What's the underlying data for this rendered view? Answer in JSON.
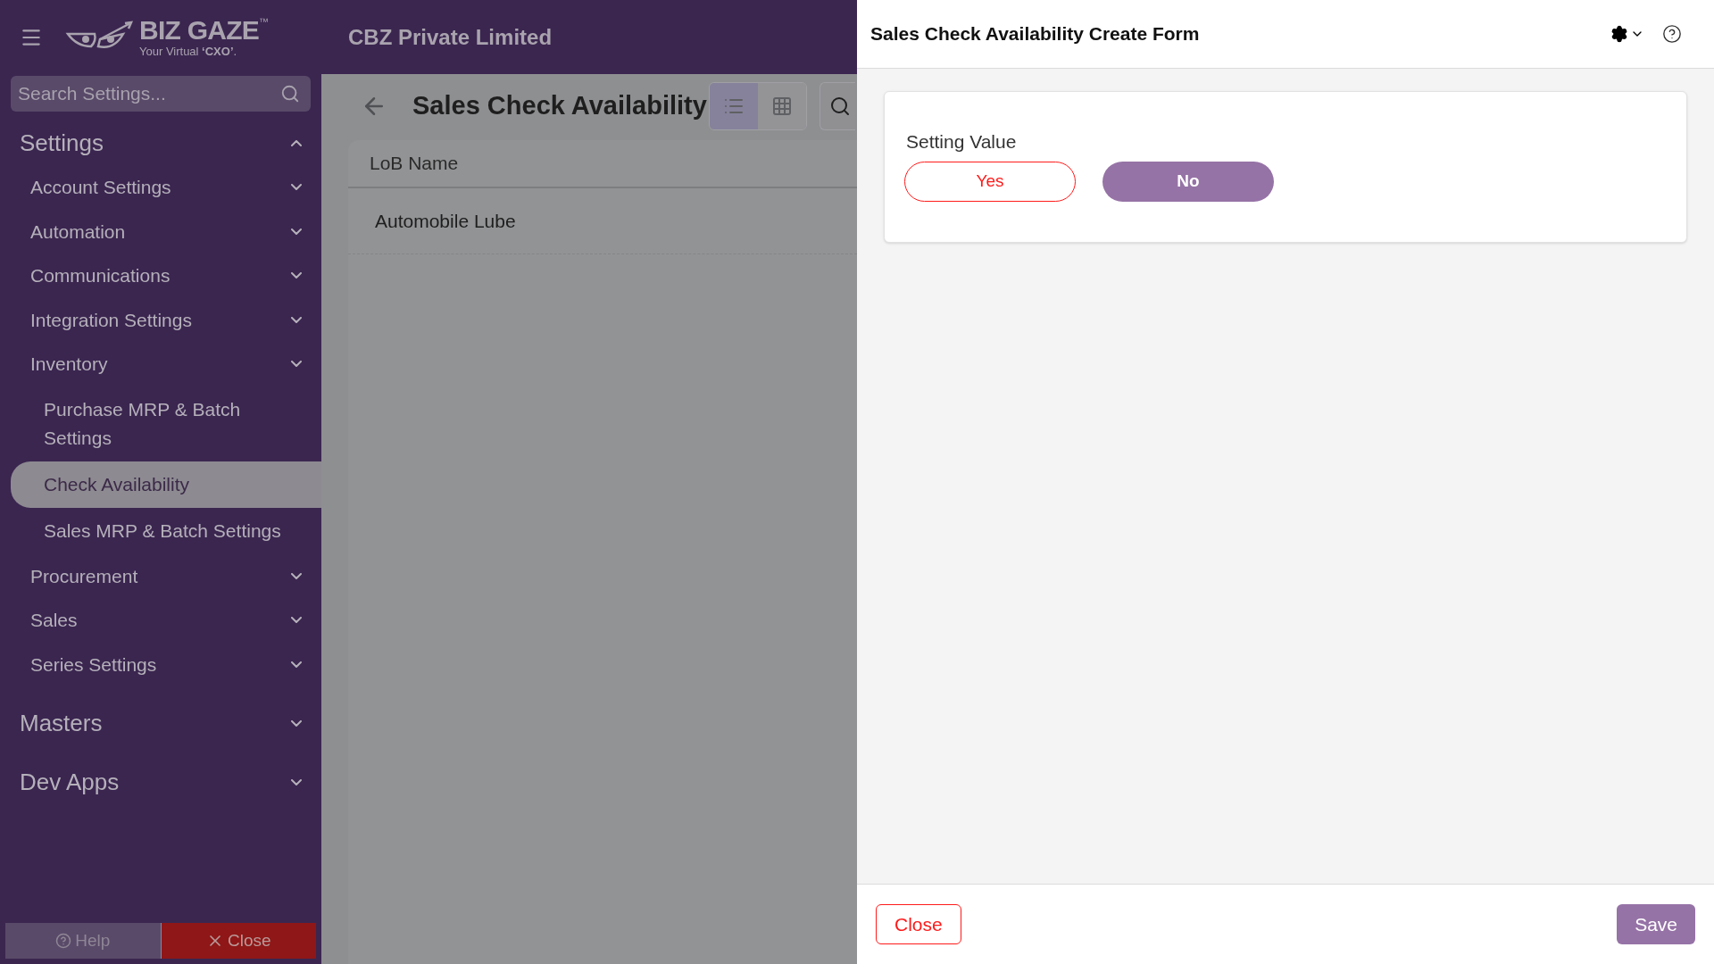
{
  "header": {
    "logo": {
      "name": "BIZ GAZE",
      "trademark": "™",
      "tagline": "Your Virtual **‘CXO’**."
    },
    "company": "CBZ Private Limited"
  },
  "sidebar": {
    "search": {
      "placeholder": "Search Settings..."
    },
    "sections": [
      {
        "label": "Settings",
        "expanded": true,
        "items": [
          {
            "label": "Account Settings"
          },
          {
            "label": "Automation"
          },
          {
            "label": "Communications"
          },
          {
            "label": "Integration Settings"
          },
          {
            "label": "Inventory",
            "children": [
              {
                "label": "Purchase MRP & Batch Settings",
                "selected": false
              },
              {
                "label": "Check Availability",
                "selected": true
              },
              {
                "label": "Sales MRP & Batch Settings",
                "selected": false
              }
            ]
          },
          {
            "label": "Procurement"
          },
          {
            "label": "Sales"
          },
          {
            "label": "Series Settings"
          }
        ]
      },
      {
        "label": "Masters",
        "expanded": false
      },
      {
        "label": "Dev Apps",
        "expanded": false
      }
    ],
    "buttons": [
      {
        "kind": "help",
        "label": "Help"
      },
      {
        "kind": "close",
        "label": "Close"
      }
    ]
  },
  "main": {
    "title": "Sales Check Availability",
    "views": [
      {
        "kind": "list",
        "selected": true
      },
      {
        "kind": "grid",
        "selected": false
      }
    ],
    "table": {
      "columns": [
        "LoB Name"
      ],
      "rows": [
        [
          "Automobile Lube"
        ]
      ]
    }
  },
  "panel": {
    "title": "Sales Check Availability Create Form",
    "field": {
      "label": "Setting Value",
      "options": [
        {
          "label": "Yes",
          "selected": false
        },
        {
          "label": "No",
          "selected": true
        }
      ]
    },
    "buttons": [
      {
        "kind": "close",
        "label": "Close"
      },
      {
        "kind": "save",
        "label": "Save"
      }
    ]
  }
}
